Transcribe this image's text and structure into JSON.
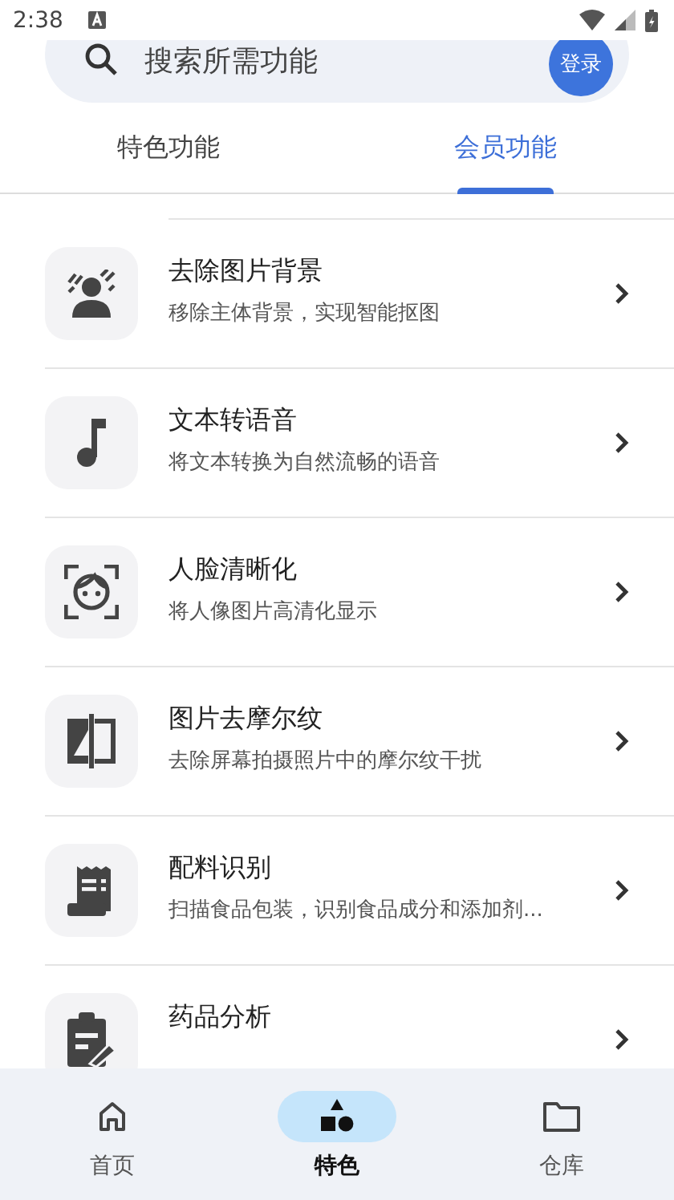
{
  "status_bar": {
    "time": "2:38"
  },
  "search": {
    "placeholder": "搜索所需功能",
    "login_button": "登录"
  },
  "tabs": [
    {
      "label": "特色功能",
      "selected": false
    },
    {
      "label": "会员功能",
      "selected": true
    }
  ],
  "features": [
    {
      "kind": "person",
      "title": "去除图片背景",
      "subtitle": "移除主体背景，实现智能抠图"
    },
    {
      "kind": "music",
      "title": "文本转语音",
      "subtitle": "将文本转换为自然流畅的语音"
    },
    {
      "kind": "face",
      "title": "人脸清晰化",
      "subtitle": "将人像图片高清化显示"
    },
    {
      "kind": "compare",
      "title": "图片去摩尔纹",
      "subtitle": "去除屏幕拍摄照片中的摩尔纹干扰"
    },
    {
      "kind": "receipt",
      "title": "配料识别",
      "subtitle": "扫描食品包装，识别食品成分和添加剂..."
    },
    {
      "kind": "clipboard",
      "title": "药品分析"
    }
  ],
  "nav": [
    {
      "kind": "home",
      "label": "首页",
      "selected": false
    },
    {
      "kind": "shapes",
      "label": "特色",
      "selected": true
    },
    {
      "kind": "folder",
      "label": "仓库",
      "selected": false
    }
  ]
}
